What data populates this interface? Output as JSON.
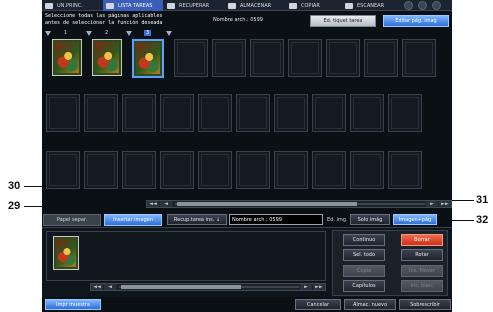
{
  "topbar": {
    "tabs": [
      {
        "label": "UN.PRINC.",
        "icon": "home-icon"
      },
      {
        "label": "LISTA TAREAS",
        "icon": "job-list-icon"
      },
      {
        "label": "RECUPERAR",
        "icon": "recall-icon"
      },
      {
        "label": "ALMACENAR",
        "icon": "store-icon"
      },
      {
        "label": "COPIAR",
        "icon": "copy-icon"
      },
      {
        "label": "ESCANEAR",
        "icon": "scan-icon"
      }
    ]
  },
  "message": "Seleccione todas las páginas aplicables\nantes de seleccionar la función deseada",
  "file_name": "Nombre arch.: 0599",
  "header_buttons": {
    "edit_ticket": "Ed. tiquet tarea",
    "edit_image": "Editar pág. imag"
  },
  "pages": {
    "numbers": [
      "1",
      "2",
      "3"
    ],
    "selected_index": 2
  },
  "grid_scroll": {
    "first": "◄◄",
    "prev": "◄",
    "next": "►",
    "last": "►►"
  },
  "middle": {
    "tab_separator": "Papel separ.",
    "tab_insert": "Insertar imagen",
    "recall_button": "Recup.tarea ins. ↓",
    "file_field": "Nombre arch.:   0599",
    "edit_label": "Ed. img",
    "single_image": "Solo imág",
    "image_page": "Imagen+pág"
  },
  "ops": {
    "continuous": "Continuo",
    "delete": "Borrar",
    "select_all": "Sel. todo",
    "rotate": "Rotar",
    "copy": "Copia",
    "move_insert": "Ins. Mover",
    "chapters": "Capítulos",
    "insert_blank": "Ins. blan."
  },
  "bottom": {
    "print_sample": "Impr muestra",
    "cancel": "Cancelar",
    "store_new": "Almac. nuevo",
    "overwrite": "Sobrescribir"
  },
  "callouts": {
    "c30": "30",
    "c29": "29",
    "c31": "31",
    "c32": "32"
  },
  "colors": {
    "accent": "#3b6fd6",
    "delete_button": "#d9452a",
    "screen_bg": "#0b1014"
  }
}
